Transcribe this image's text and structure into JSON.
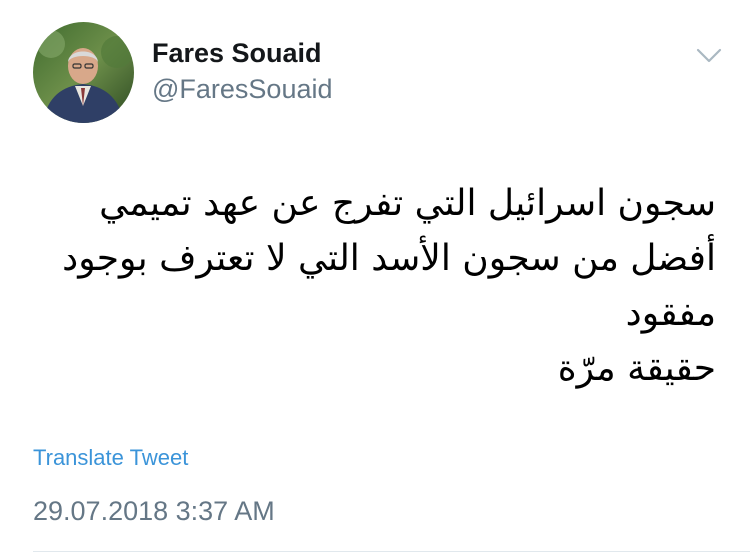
{
  "author": {
    "display_name": "Fares Souaid",
    "handle": "@FaresSouaid",
    "avatar_icon": "profile-photo"
  },
  "tweet": {
    "lines": [
      "سجون اسرائيل التي تفرج عن عهد تميمي",
      "أفضل من سجون الأسد التي لا تعترف بوجود",
      "مفقود",
      "حقيقة مرّة"
    ],
    "translate_label": "Translate Tweet",
    "timestamp": "29.07.2018 3:37 AM"
  },
  "icons": {
    "menu": "chevron-down-icon"
  },
  "colors": {
    "link": "#3b94d9",
    "secondary_text": "#657786",
    "primary_text": "#14171a",
    "divider": "#e1e8ed"
  }
}
